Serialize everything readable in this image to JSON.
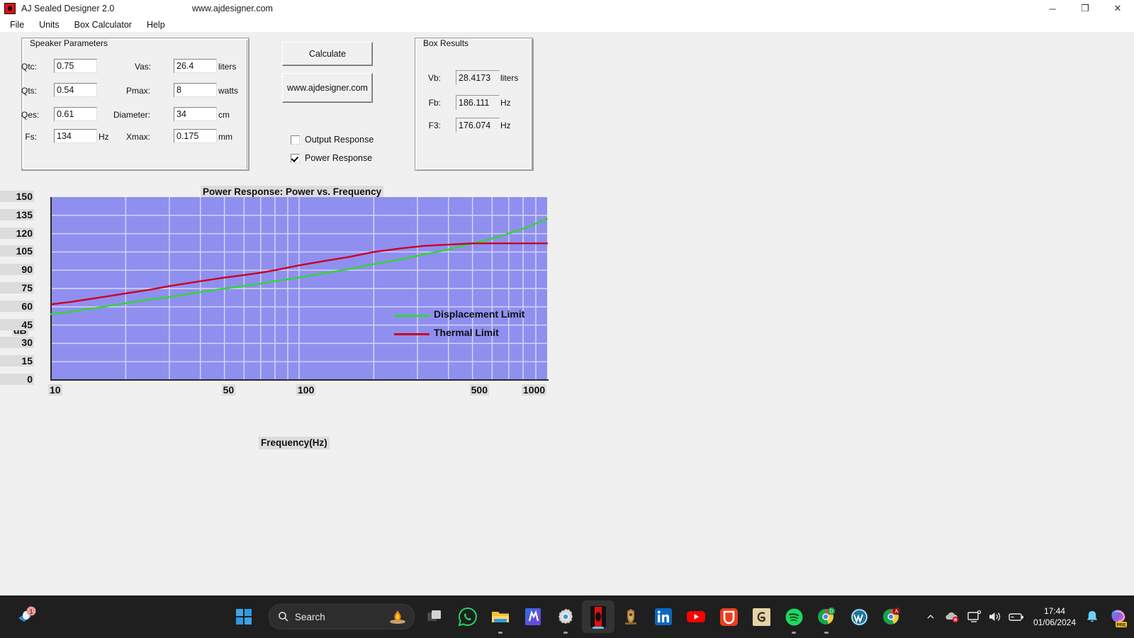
{
  "window": {
    "title": "AJ Sealed Designer 2.0",
    "url": "www.ajdesigner.com",
    "icon": "app-icon",
    "minimize": "─",
    "maximize": "❐",
    "close": "✕"
  },
  "menubar": {
    "items": [
      {
        "label": "File"
      },
      {
        "label": "Units"
      },
      {
        "label": "Box Calculator"
      },
      {
        "label": "Help"
      }
    ]
  },
  "speaker_parameters": {
    "title": "Speaker Parameters",
    "fields": [
      {
        "label": "Qtc:",
        "value": "0.75",
        "unit": ""
      },
      {
        "label": "Qts:",
        "value": "0.54",
        "unit": ""
      },
      {
        "label": "Qes:",
        "value": "0.61",
        "unit": ""
      },
      {
        "label": "Fs:",
        "value": "134",
        "unit": "Hz"
      },
      {
        "label": "Vas:",
        "value": "26.4",
        "unit": "liters"
      },
      {
        "label": "Pmax:",
        "value": "8",
        "unit": "watts"
      },
      {
        "label": "Diameter:",
        "value": "34",
        "unit": "cm"
      },
      {
        "label": "Xmax:",
        "value": "0.175",
        "unit": "mm"
      }
    ]
  },
  "actions": {
    "calculate_label": "Calculate",
    "website_label": "www.ajdesigner.com",
    "checkboxes": [
      {
        "label": "Output Response",
        "checked": false
      },
      {
        "label": "Power Response",
        "checked": true
      }
    ]
  },
  "box_results": {
    "title": "Box Results",
    "fields": [
      {
        "label": "Vb:",
        "value": "28.4173",
        "unit": "liters"
      },
      {
        "label": "Fb:",
        "value": "186.111",
        "unit": "Hz"
      },
      {
        "label": "F3:",
        "value": "176.074",
        "unit": "Hz"
      }
    ]
  },
  "chart_data": {
    "type": "line",
    "title": "Power Response: Power vs. Frequency",
    "xlabel": "Frequency(Hz)",
    "ylabel": "dB",
    "xscale": "log",
    "xlim": [
      10,
      1000
    ],
    "ylim": [
      0,
      150
    ],
    "yticks": [
      0,
      15,
      30,
      45,
      60,
      75,
      90,
      105,
      120,
      135,
      150
    ],
    "xticks": [
      10,
      50,
      100,
      500,
      1000
    ],
    "xticklabels": [
      "10",
      "50",
      "100",
      "500",
      "1000"
    ],
    "xgridlines": [
      20,
      30,
      40,
      50,
      60,
      70,
      80,
      90,
      100,
      200,
      300,
      400,
      500,
      600,
      700,
      800,
      900
    ],
    "grid": true,
    "plot_background": "#8f8ff0",
    "grid_color": "#d8d8f5",
    "legend_position": "bottom-right",
    "series": [
      {
        "name": "Displacement Limit",
        "color": "#33d633",
        "x": [
          10,
          12,
          15,
          20,
          25,
          30,
          40,
          50,
          60,
          70,
          80,
          100,
          130,
          160,
          200,
          260,
          320,
          400,
          500,
          630,
          800,
          1000
        ],
        "values": [
          54,
          56,
          59,
          63,
          66,
          68,
          72,
          75,
          77,
          79,
          81,
          84,
          88,
          91,
          95,
          99,
          103,
          107,
          112,
          117,
          124,
          132
        ]
      },
      {
        "name": "Thermal Limit",
        "color": "#cc0022",
        "x": [
          10,
          12,
          15,
          20,
          25,
          30,
          40,
          50,
          60,
          70,
          80,
          100,
          130,
          160,
          200,
          260,
          320,
          400,
          500,
          630,
          800,
          1000
        ],
        "values": [
          62,
          64,
          67,
          71,
          74,
          77,
          81,
          84,
          86,
          88,
          90,
          94,
          98,
          101,
          105,
          108,
          110,
          111,
          112,
          112,
          112,
          112
        ]
      }
    ]
  },
  "taskbar": {
    "start_label": "start-button",
    "search_placeholder": "Search",
    "apps": [
      {
        "name": "task-view"
      },
      {
        "name": "whatsapp"
      },
      {
        "name": "file-explorer"
      },
      {
        "name": "app-blue-m"
      },
      {
        "name": "settings-gear"
      },
      {
        "name": "aj-designer"
      },
      {
        "name": "crest-app"
      },
      {
        "name": "linkedin"
      },
      {
        "name": "youtube"
      },
      {
        "name": "opera-gx"
      },
      {
        "name": "gnome-app"
      },
      {
        "name": "spotify"
      },
      {
        "name": "chrome-d"
      },
      {
        "name": "wordpress"
      },
      {
        "name": "chrome-a"
      }
    ],
    "tray": {
      "overflow": "⌃",
      "time": "17:44",
      "date": "01/06/2024",
      "copilot_badge": "PRE"
    }
  }
}
